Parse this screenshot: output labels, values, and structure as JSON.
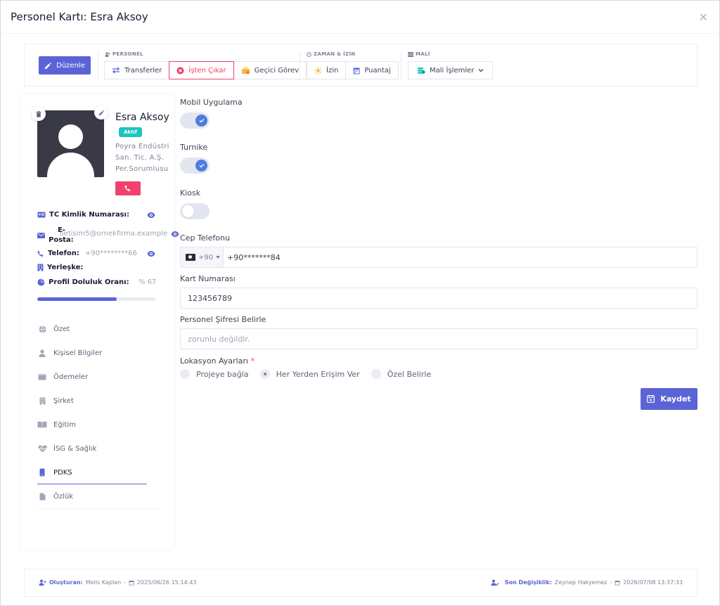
{
  "modal": {
    "title": "Personel Kartı: Esra Aksoy",
    "close": "✕"
  },
  "toolbar": {
    "edit_label": "Düzenle",
    "groups": {
      "personel": "PERSONEL",
      "zaman": "ZAMAN & İZİN",
      "mali": "MALİ"
    },
    "buttons": {
      "transferler": "Transferler",
      "isten_cikar": "İşten Çıkar",
      "gecici_gorev": "Geçici Görev",
      "izin": "İzin",
      "puantaj": "Puantaj",
      "mali_islemler": "Mali İşlemler"
    }
  },
  "profile": {
    "name": "Esra Aksoy",
    "status": "Aktif",
    "company": "Poyra Endüstri San. Tic. A.Ş.",
    "role": "Per.Sorumlusu"
  },
  "info": {
    "tc_label": "TC Kimlik Numarası:",
    "email_label": "E-Posta:",
    "email_value": "iletisim5@ornekfirma.example",
    "phone_label": "Telefon:",
    "phone_value": "+90********66",
    "campus_label": "Yerleşke:",
    "completion_label": "Profil Doluluk Oranı:",
    "completion_value": "% 67",
    "completion_fraction": 0.67
  },
  "nav": {
    "items": [
      {
        "label": "Özet",
        "icon": "globe-icon"
      },
      {
        "label": "Kişisel Bilgiler",
        "icon": "user-icon"
      },
      {
        "label": "Ödemeler",
        "icon": "wallet-icon"
      },
      {
        "label": "Şirket",
        "icon": "building-icon"
      },
      {
        "label": "Eğitim",
        "icon": "book-icon"
      },
      {
        "label": "İSG & Sağlık",
        "icon": "heartbeat-icon"
      },
      {
        "label": "PDKS",
        "icon": "mobile-icon"
      },
      {
        "label": "Özlük",
        "icon": "file-icon"
      }
    ],
    "active": "PDKS"
  },
  "form": {
    "mobile_app_label": "Mobil Uygulama",
    "mobile_app_on": true,
    "turnstile_label": "Turnike",
    "turnstile_on": true,
    "kiosk_label": "Kiosk",
    "kiosk_on": false,
    "cell_phone_label": "Cep Telefonu",
    "cell_phone_prefix": "+90",
    "cell_phone_value": "+90*******84",
    "card_number_label": "Kart Numarası",
    "card_number_value": "123456789",
    "password_label": "Personel Şifresi Belirle",
    "password_placeholder": "zorunlu değildir.",
    "location_label": "Lokasyon Ayarları",
    "required_mark": "*",
    "location_options": [
      "Projeye bağla",
      "Her Yerden Erişim Ver",
      "Özel Belirle"
    ],
    "location_selected": "Her Yerden Erişim Ver",
    "save_label": "Kaydet"
  },
  "footer": {
    "created_label": "Oluşturan:",
    "created_by": "Melis Kaplan",
    "created_at": "2025/06/26 15:14:43",
    "modified_label": "Son Değişiklik:",
    "modified_by": "Zeynep Hakyemez",
    "modified_at": "2026/07/08 13:37:33",
    "separator": "-"
  },
  "colors": {
    "primary": "#5b64d6",
    "danger": "#f1416c",
    "success": "#1bc5bd",
    "toggle_on": "#4a7dde"
  }
}
